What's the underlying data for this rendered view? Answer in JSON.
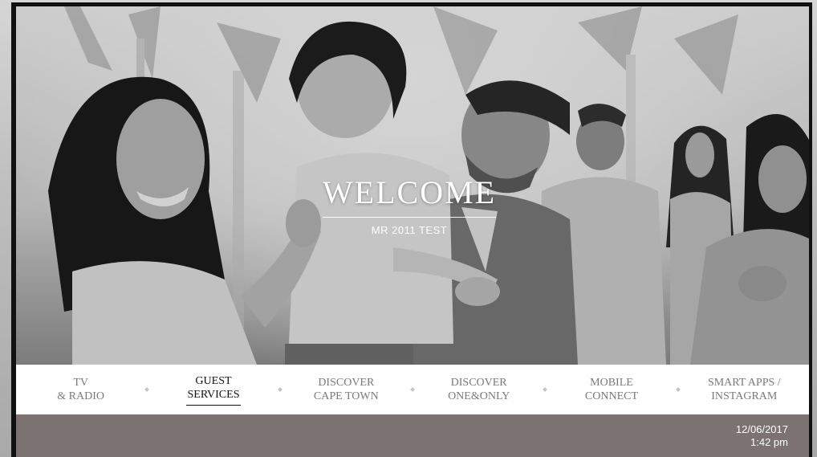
{
  "welcome": {
    "title": "WELCOME",
    "guest_name": "MR 2011 TEST"
  },
  "nav": {
    "items": [
      {
        "line1": "TV",
        "line2": "& RADIO"
      },
      {
        "line1": "GUEST",
        "line2": "SERVICES"
      },
      {
        "line1": "DISCOVER",
        "line2": "CAPE TOWN"
      },
      {
        "line1": "DISCOVER",
        "line2": "ONE&ONLY"
      },
      {
        "line1": "MOBILE",
        "line2": "CONNECT"
      },
      {
        "line1": "SMART APPS /",
        "line2": "INSTAGRAM"
      }
    ],
    "active_index": 1
  },
  "status": {
    "date": "12/06/2017",
    "time": "1:42 pm"
  },
  "colors": {
    "nav_background": "#ffffff",
    "status_bar": "#7b7271",
    "active_text": "#111111",
    "inactive_text": "#7a7a7a"
  }
}
